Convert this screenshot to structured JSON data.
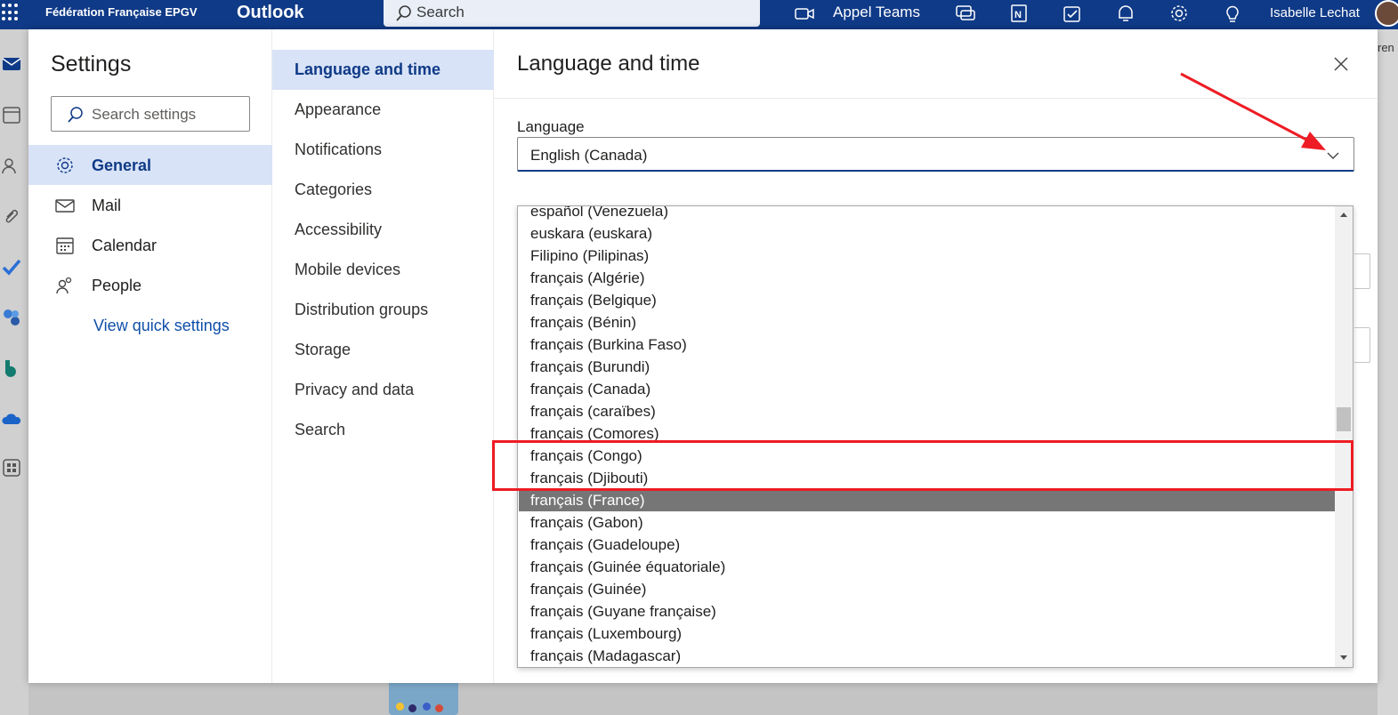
{
  "topbar": {
    "org_name": "Fédération Française EPGV",
    "app_name": "Outlook",
    "search_placeholder": "Search",
    "teams_call": "Appel Teams",
    "user_name": "Isabelle Lechat"
  },
  "background": {
    "right_fragment": "ren"
  },
  "settings": {
    "title": "Settings",
    "search_placeholder": "Search settings",
    "categories": [
      {
        "label": "General",
        "icon": "gear-icon",
        "active": true
      },
      {
        "label": "Mail",
        "icon": "mail-icon",
        "active": false
      },
      {
        "label": "Calendar",
        "icon": "calendar-icon",
        "active": false
      },
      {
        "label": "People",
        "icon": "people-icon",
        "active": false
      }
    ],
    "quick_settings_link": "View quick settings",
    "subcategories": [
      {
        "label": "Language and time",
        "active": true
      },
      {
        "label": "Appearance",
        "active": false
      },
      {
        "label": "Notifications",
        "active": false
      },
      {
        "label": "Categories",
        "active": false
      },
      {
        "label": "Accessibility",
        "active": false
      },
      {
        "label": "Mobile devices",
        "active": false
      },
      {
        "label": "Distribution groups",
        "active": false
      },
      {
        "label": "Storage",
        "active": false
      },
      {
        "label": "Privacy and data",
        "active": false
      },
      {
        "label": "Search",
        "active": false
      }
    ]
  },
  "pane": {
    "title": "Language and time",
    "language_label": "Language",
    "language_value": "English (Canada)",
    "language_options": [
      "español (Venezuela)",
      "euskara (euskara)",
      "Filipino (Pilipinas)",
      "français (Algérie)",
      "français (Belgique)",
      "français (Bénin)",
      "français (Burkina Faso)",
      "français (Burundi)",
      "français (Canada)",
      "français (caraïbes)",
      "français (Comores)",
      "français (Congo)",
      "français (Djibouti)",
      "français (France)",
      "français (Gabon)",
      "français (Guadeloupe)",
      "français (Guinée équatoriale)",
      "français (Guinée)",
      "français (Guyane française)",
      "français (Luxembourg)",
      "français (Madagascar)"
    ],
    "highlighted_option": "français (France)"
  },
  "colors": {
    "brand": "#0f3a87",
    "active_bg": "#d8e3f7",
    "annotation": "#ee1c24",
    "option_selected": "#767676"
  }
}
